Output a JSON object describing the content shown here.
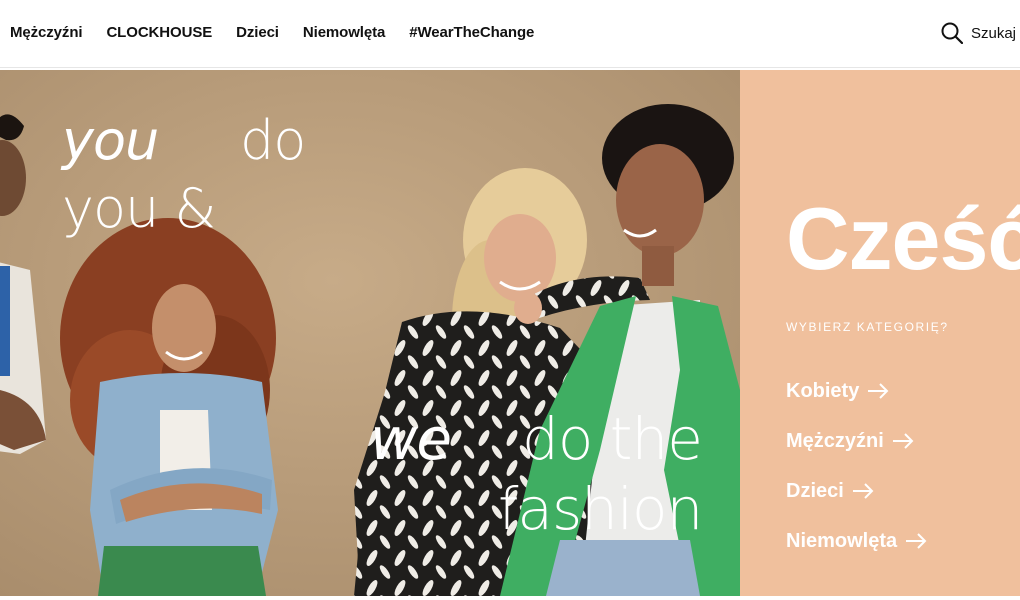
{
  "nav": {
    "items": [
      {
        "label": "Mężczyźni"
      },
      {
        "label": "CLOCKHOUSE"
      },
      {
        "label": "Dzieci"
      },
      {
        "label": "Niemowlęta"
      },
      {
        "label": "#WearTheChange"
      }
    ],
    "search_label": "Szukaj",
    "search_icon": "search-icon"
  },
  "hero": {
    "line1_a": "you",
    "line1_b": "do",
    "line2": "you &",
    "line3_a": "we",
    "line3_b": "do the",
    "line4": "fashion"
  },
  "panel": {
    "greeting": "Cześć",
    "category_title": "WYBIERZ KATEGORIĘ?",
    "categories": [
      {
        "label": "Kobiety"
      },
      {
        "label": "Mężczyźni"
      },
      {
        "label": "Dzieci"
      },
      {
        "label": "Niemowlęta"
      }
    ],
    "arrow_icon": "arrow-right-icon"
  },
  "colors": {
    "panel_bg": "#f0c09d",
    "wall": "#b89e7e",
    "text_on_panel": "#ffffff",
    "jacket_green": "#3fae62"
  }
}
